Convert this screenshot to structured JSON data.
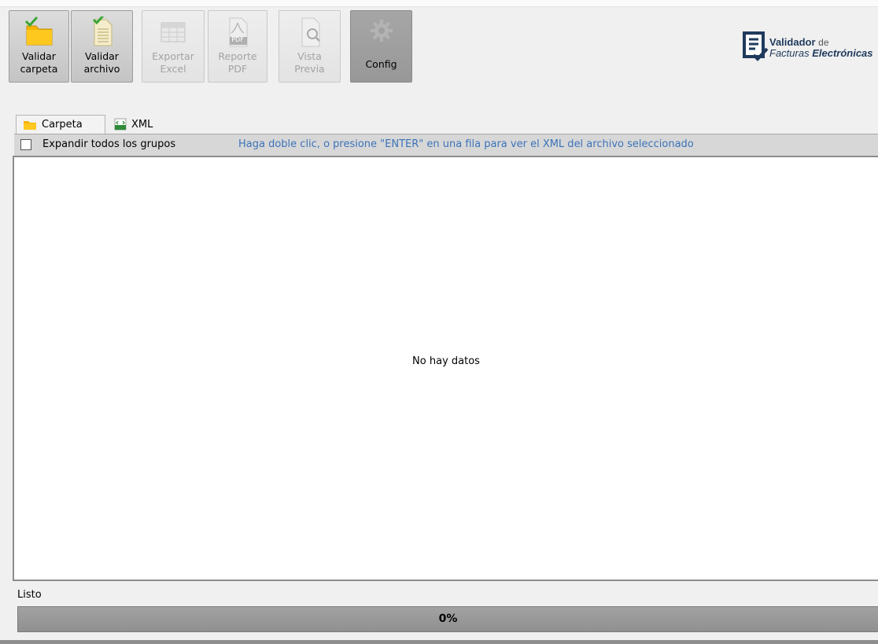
{
  "toolbar": {
    "buttons": [
      {
        "id": "validar-carpeta",
        "label": "Validar\ncarpeta",
        "enabled": true
      },
      {
        "id": "validar-archivo",
        "label": "Validar\narchivo",
        "enabled": true
      },
      {
        "id": "exportar-excel",
        "label": "Exportar\nExcel",
        "enabled": false
      },
      {
        "id": "reporte-pdf",
        "label": "Reporte\nPDF",
        "enabled": false
      },
      {
        "id": "vista-previa",
        "label": "Vista\nPrevia",
        "enabled": false
      },
      {
        "id": "config",
        "label": "Config",
        "enabled": true
      }
    ],
    "pdf_icon_text": "PDF"
  },
  "logo": {
    "name_bold": "Validador",
    "name_light": "de",
    "sub_light": "Facturas",
    "sub_bold": "Electrónicas"
  },
  "tabs": [
    {
      "label": "Carpeta",
      "icon": "folder-icon",
      "active": true
    },
    {
      "label": "XML",
      "icon": "xml-file-icon",
      "active": false
    }
  ],
  "options": {
    "expand_label": "Expandir todos los grupos",
    "expand_checked": false,
    "hint": "Haga doble clic, o presione \"ENTER\" en una fila para ver el XML del archivo seleccionado"
  },
  "grid": {
    "empty_text": "No hay datos"
  },
  "status": {
    "text": "Listo",
    "progress_text": "0%",
    "progress_value": 0
  },
  "colors": {
    "hint": "#3b73b9",
    "logo": "#1f3a5c",
    "folder": "#f5b400",
    "check": "#3aa635"
  }
}
